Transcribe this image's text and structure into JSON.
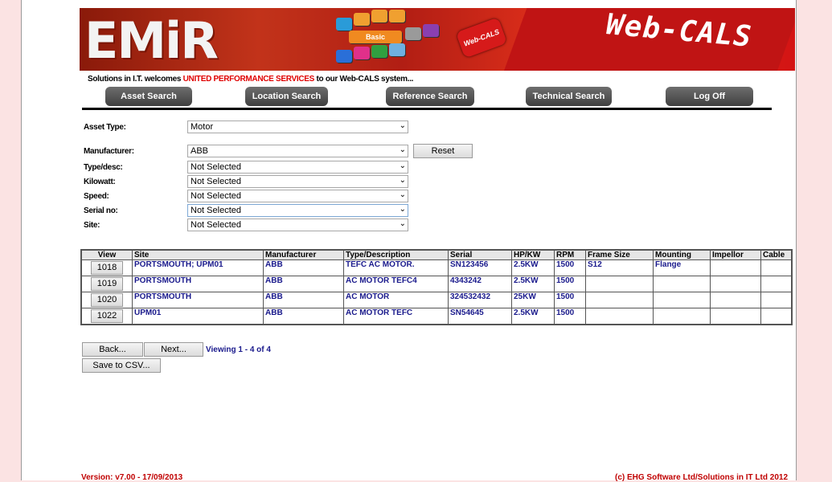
{
  "banner": {
    "logo": "EMiR",
    "key_label": "Basic",
    "badge": "Web-CALS",
    "product": "Web-CALS"
  },
  "welcome": {
    "prefix": "Solutions in I.T. welcomes",
    "company": "UNITED PERFORMANCE SERVICES",
    "suffix": "to our Web-CALS system..."
  },
  "nav": [
    "Asset Search",
    "Location Search",
    "Reference Search",
    "Technical Search",
    "Log Off"
  ],
  "filters": {
    "asset_type": {
      "label": "Asset Type:",
      "value": "Motor"
    },
    "manufacturer": {
      "label": "Manufacturer:",
      "value": "ABB"
    },
    "type_desc": {
      "label": "Type/desc:",
      "value": "Not Selected"
    },
    "kilowatt": {
      "label": "Kilowatt:",
      "value": "Not Selected"
    },
    "speed": {
      "label": "Speed:",
      "value": "Not Selected"
    },
    "serial": {
      "label": "Serial no:",
      "value": "Not Selected"
    },
    "site": {
      "label": "Site:",
      "value": "Not Selected"
    }
  },
  "reset_label": "Reset",
  "table": {
    "headers": [
      "View",
      "Site",
      "Manufacturer",
      "Type/Description",
      "Serial",
      "HP/KW",
      "RPM",
      "Frame Size",
      "Mounting",
      "Impellor",
      "Cable"
    ],
    "rows": [
      {
        "view": "1018",
        "site": "PORTSMOUTH; UPM01",
        "manufacturer": "ABB",
        "type": "TEFC AC MOTOR.",
        "serial": "SN123456",
        "hpkw": "2.5KW",
        "rpm": "1500",
        "frame": "S12",
        "mounting": "Flange",
        "impellor": "",
        "cable": ""
      },
      {
        "view": "1019",
        "site": "PORTSMOUTH",
        "manufacturer": "ABB",
        "type": "AC MOTOR TEFC4",
        "serial": "4343242",
        "hpkw": "2.5KW",
        "rpm": "1500",
        "frame": "",
        "mounting": "",
        "impellor": "",
        "cable": ""
      },
      {
        "view": "1020",
        "site": "PORTSMOUTH",
        "manufacturer": "ABB",
        "type": "AC MOTOR",
        "serial": "324532432",
        "hpkw": "25KW",
        "rpm": "1500",
        "frame": "",
        "mounting": "",
        "impellor": "",
        "cable": ""
      },
      {
        "view": "1022",
        "site": "UPM01",
        "manufacturer": "ABB",
        "type": "AC MOTOR TEFC",
        "serial": "SN54645",
        "hpkw": "2.5KW",
        "rpm": "1500",
        "frame": "",
        "mounting": "",
        "impellor": "",
        "cable": ""
      }
    ]
  },
  "pager": {
    "back": "Back...",
    "next": "Next...",
    "viewing": "Viewing 1 - 4 of 4",
    "csv": "Save to CSV..."
  },
  "footer": {
    "version": "Version: v7.00 - 17/09/2013",
    "copyright": "(c) EHG Software Ltd/Solutions in IT Ltd 2012"
  },
  "colors": {
    "company_red": "#e00000",
    "link_blue": "#1a1a8c",
    "page_bg": "#fbe3e3"
  }
}
